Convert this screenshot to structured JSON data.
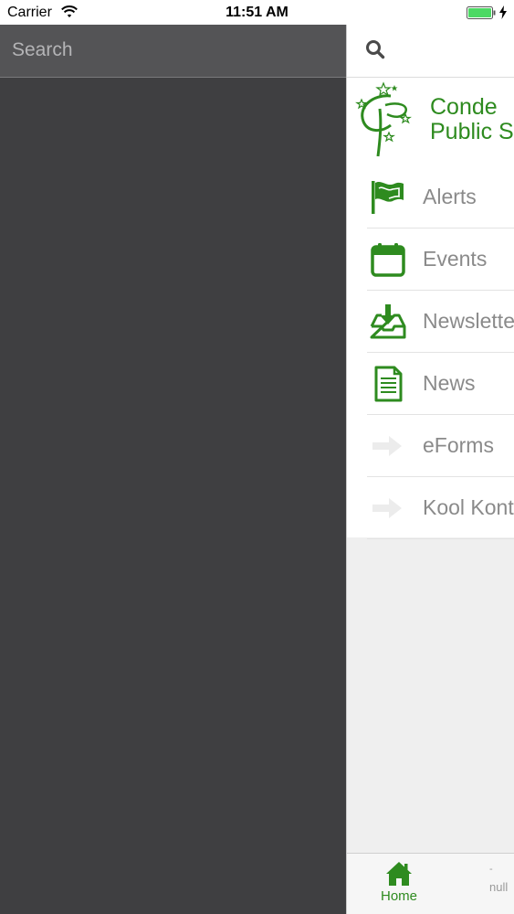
{
  "status_bar": {
    "carrier": "Carrier",
    "time": "11:51 AM",
    "battery_color": "#4cd964"
  },
  "search": {
    "placeholder": "Search"
  },
  "logo": {
    "line1": "Conde",
    "line2": "Public S"
  },
  "menu": {
    "items": [
      {
        "label": "Alerts",
        "icon": "flag-icon"
      },
      {
        "label": "Events",
        "icon": "calendar-icon"
      },
      {
        "label": "Newslette",
        "icon": "inbox-download-icon"
      },
      {
        "label": "News",
        "icon": "document-icon"
      },
      {
        "label": "eForms",
        "icon": "arrow-right-icon"
      },
      {
        "label": "Kool Kont",
        "icon": "arrow-right-icon"
      }
    ]
  },
  "tab_bar": {
    "home_label": "Home",
    "second_dash": "-",
    "second_label": "null"
  },
  "colors": {
    "accent_green": "#2e8b1f",
    "overlay_dark": "#3f3f41"
  }
}
